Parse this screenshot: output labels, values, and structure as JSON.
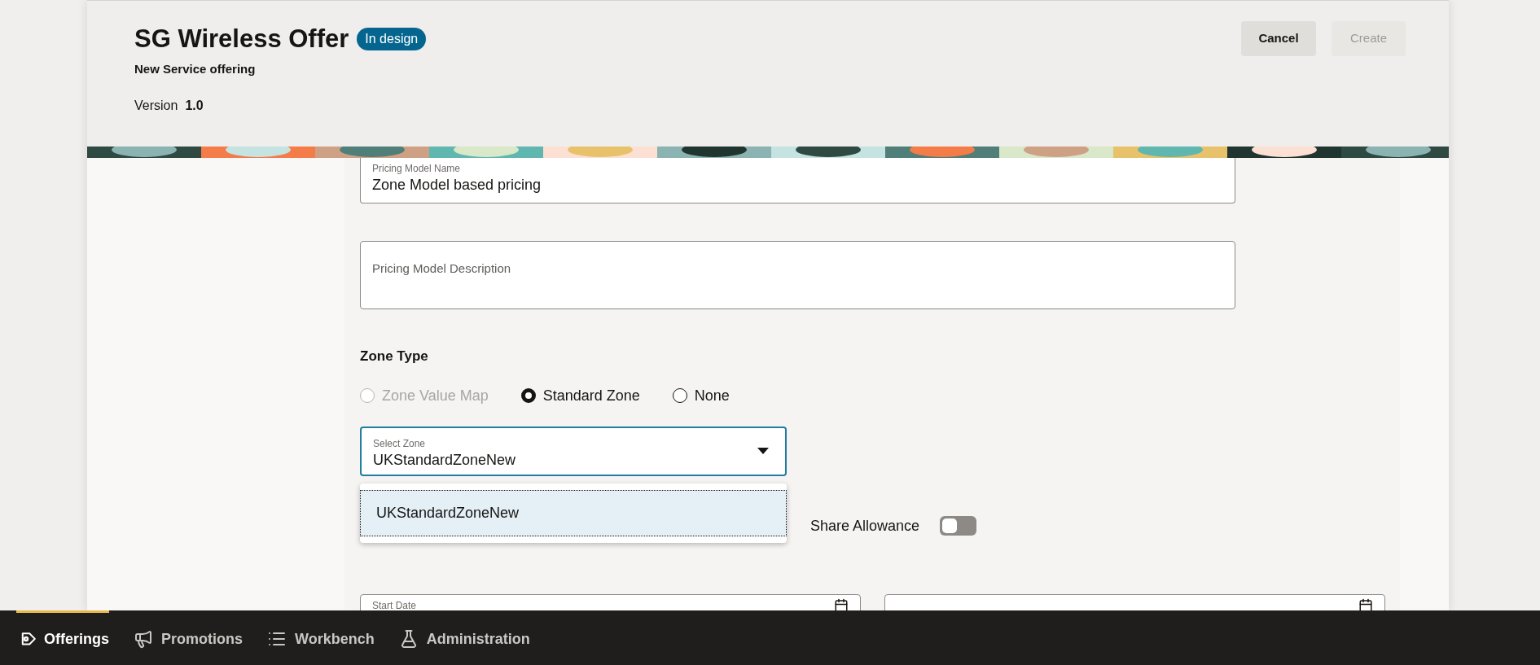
{
  "header": {
    "title": "SG Wireless Offer",
    "status_badge": "In design",
    "subtitle": "New Service offering",
    "version_label": "Version",
    "version": "1.0",
    "buttons": [
      {
        "label": "Cancel",
        "disabled": false
      },
      {
        "label": "Create",
        "disabled": true
      }
    ]
  },
  "form": {
    "pricing_model_name": {
      "label": "Pricing Model Name",
      "value": "Zone Model based pricing"
    },
    "pricing_model_description": {
      "placeholder": "Pricing Model Description"
    },
    "zone_type": {
      "label": "Zone Type",
      "options": [
        {
          "label": "Zone Value Map",
          "selected": false,
          "disabled": true
        },
        {
          "label": "Standard Zone",
          "selected": true,
          "disabled": false
        },
        {
          "label": "None",
          "selected": false,
          "disabled": false
        }
      ]
    },
    "select_zone": {
      "label": "Select Zone",
      "value": "UKStandardZoneNew",
      "expanded": true,
      "options": [
        {
          "label": "UKStandardZoneNew",
          "selected": true
        }
      ]
    },
    "share_allowance": {
      "label": "Share Allowance",
      "on": false
    },
    "start_date": {
      "label": "Start Date"
    }
  },
  "nav": [
    {
      "label": "Offerings",
      "selected": true
    },
    {
      "label": "Promotions",
      "selected": false
    },
    {
      "label": "Workbench",
      "selected": false
    },
    {
      "label": "Administration",
      "selected": false
    }
  ]
}
